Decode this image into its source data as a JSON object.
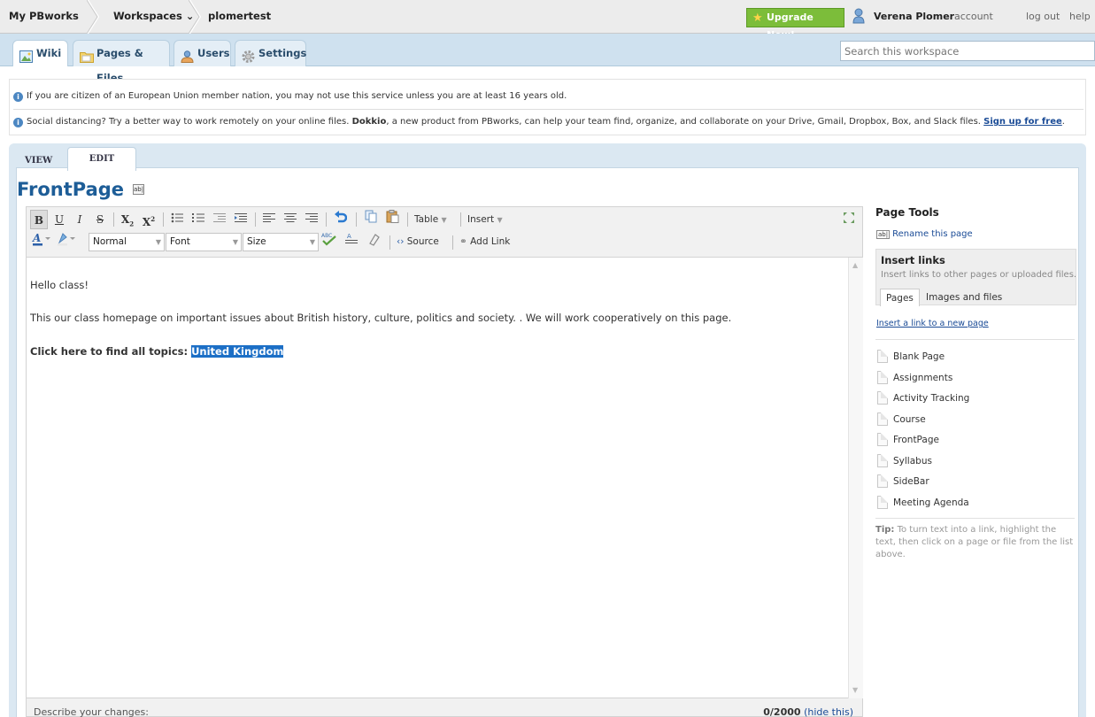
{
  "topbar": {
    "my_pbworks": "My PBworks",
    "workspaces": "Workspaces ⌄",
    "workspace_name": "plomertest",
    "upgrade": "Upgrade Now!",
    "user_name": "Verena Plomer",
    "account": "account",
    "logout": "log out",
    "help": "help"
  },
  "tabs": [
    {
      "label": "Wiki",
      "icon": "wiki-icon"
    },
    {
      "label": "Pages & Files",
      "icon": "folder-icon"
    },
    {
      "label": "Users",
      "icon": "users-icon"
    },
    {
      "label": "Settings",
      "icon": "gear-icon"
    }
  ],
  "search": {
    "placeholder": "Search this workspace"
  },
  "notices": {
    "age": "If you are citizen of an European Union member nation, you may not use this service unless you are at least 16 years old.",
    "dokkio_prefix": "Social distancing? Try a better way to work remotely on your online files. ",
    "dokkio_bold": "Dokkio",
    "dokkio_suffix": ", a new product from PBworks, can help your team find, organize, and collaborate on your Drive, Gmail, Dropbox, Box, and Slack files. ",
    "dokkio_link": "Sign up for free"
  },
  "view_tabs": {
    "view": "VIEW",
    "edit": "EDIT"
  },
  "page": {
    "title": "FrontPage",
    "rename_icon": "ab|"
  },
  "toolbar": {
    "bold": "B",
    "underline": "U",
    "italic": "I",
    "strike": "S",
    "table": "Table",
    "insert": "Insert",
    "format_select": "Normal",
    "font_select": "Font",
    "size_select": "Size",
    "source": "Source",
    "add_link": "Add Link"
  },
  "editor": {
    "line1": "Hello class!",
    "line2": "This our class homepage on important issues about British history, culture, politics and society. . We will work cooperatively on this page.",
    "line3_label": "Click here to find all topics: ",
    "line3_link": "United Kingdom"
  },
  "footer": {
    "describe": "Describe your changes:",
    "count": "0/2000",
    "hide": "(hide this)"
  },
  "tools": {
    "title": "Page Tools",
    "rename": "Rename this page",
    "insert_title": "Insert links",
    "insert_sub": "Insert links to other pages or uploaded files.",
    "tab_pages": "Pages",
    "tab_images": "Images and files",
    "new_page_link": "Insert a link to a new page",
    "pages": [
      "Blank Page",
      "Assignments",
      "Activity Tracking",
      "Course",
      "FrontPage",
      "Syllabus",
      "SideBar",
      "Meeting Agenda"
    ],
    "tip_label": "Tip:",
    "tip_text": " To turn text into a link, highlight the text, then click on a page or file from the list above."
  },
  "colors": {
    "accent": "#1d5d97",
    "upgrade": "#7cbd3a",
    "selection": "#1c6fc6"
  }
}
